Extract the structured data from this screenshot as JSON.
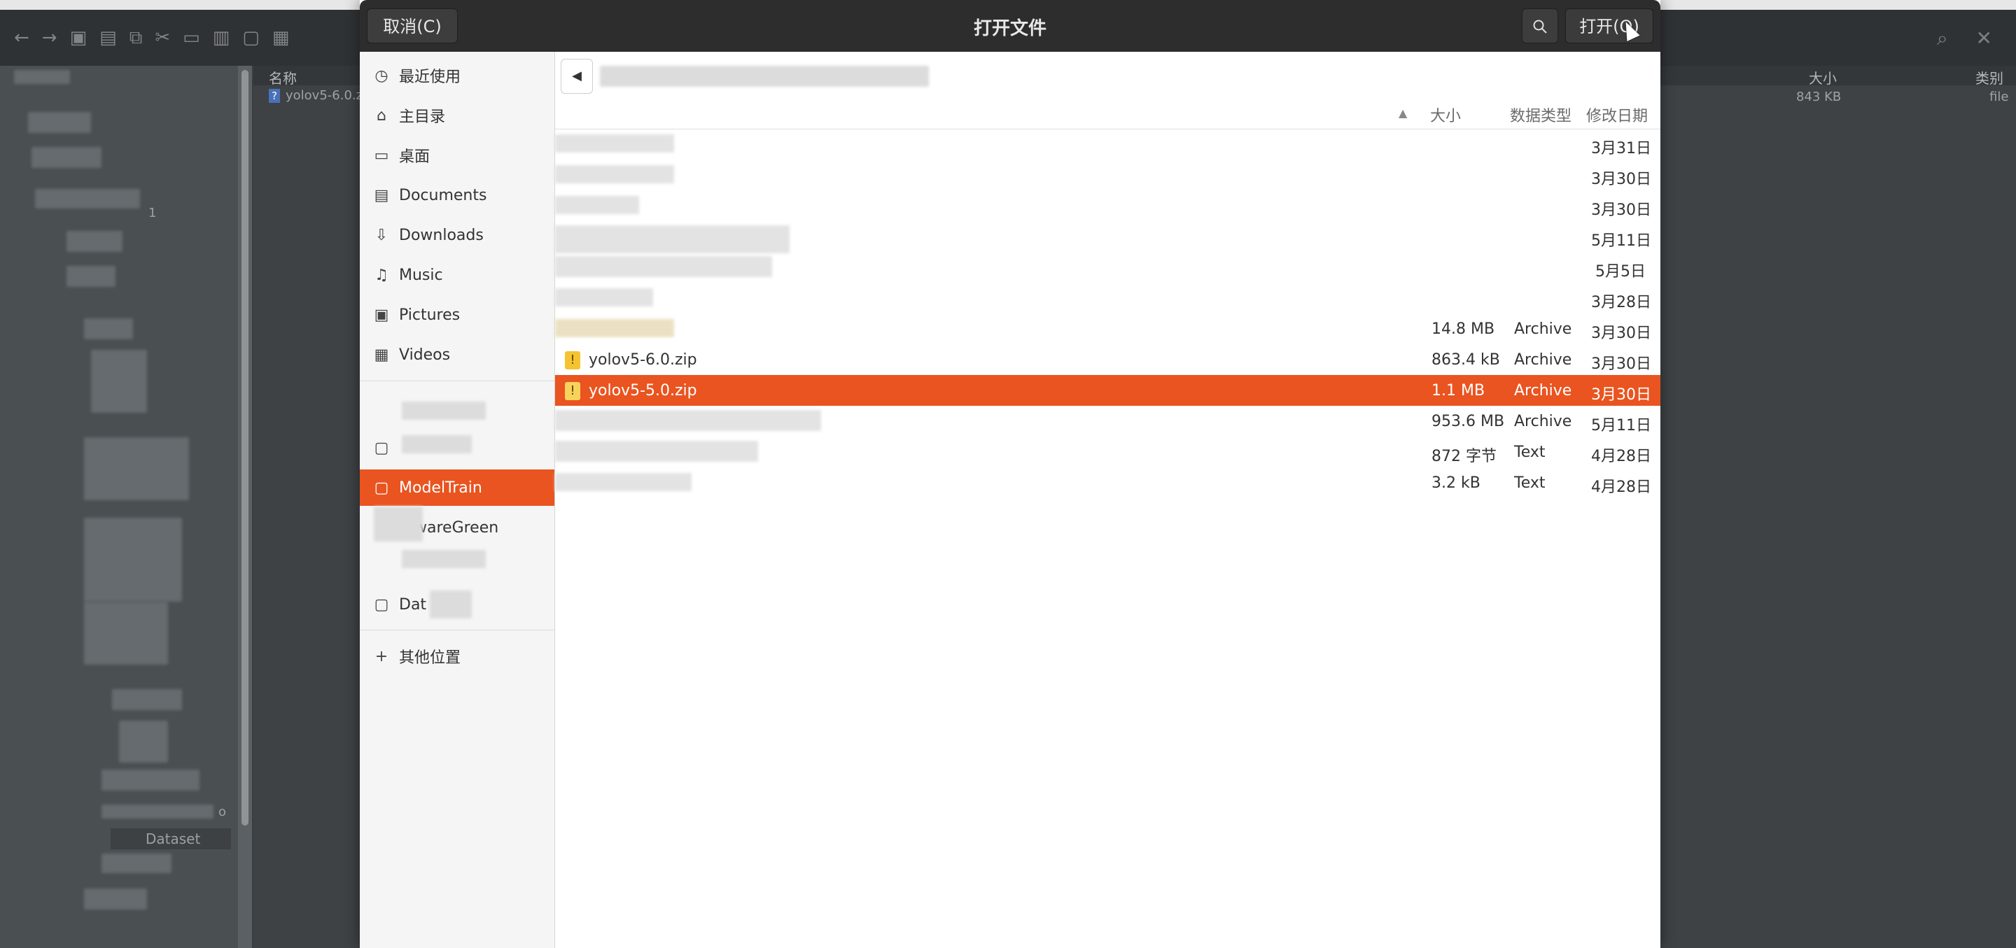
{
  "background": {
    "header": {
      "name_label": "名称",
      "size_label": "大小",
      "type_label": "类别"
    },
    "file": {
      "name": "yolov5-6.0.z",
      "size": "843 KB",
      "type": "file"
    },
    "folder_label": "Dataset",
    "tree_label_fragment": "1",
    "tree_label_fragment_2": "o"
  },
  "dialog": {
    "title": "打开文件",
    "cancel_label": "取消(C)",
    "open_label": "打开(O)",
    "search_icon": "search-icon",
    "places": [
      {
        "label": "最近使用",
        "icon": "clock-icon"
      },
      {
        "label": "主目录",
        "icon": "home-icon"
      },
      {
        "label": "桌面",
        "icon": "desktop-icon"
      },
      {
        "label": "Documents",
        "icon": "document-icon"
      },
      {
        "label": "Downloads",
        "icon": "download-icon"
      },
      {
        "label": "Music",
        "icon": "music-icon"
      },
      {
        "label": "Pictures",
        "icon": "picture-icon"
      },
      {
        "label": "Videos",
        "icon": "video-icon"
      }
    ],
    "bookmarks": [
      {
        "label": "ModelTrain",
        "icon": "folder-icon",
        "active": true
      },
      {
        "label": "wareGreen",
        "icon": "folder-icon"
      },
      {
        "label": "Dat",
        "icon": "folder-icon"
      }
    ],
    "other_locations_label": "其他位置",
    "columns": {
      "size": "大小",
      "type": "数据类型",
      "modified": "修改日期"
    },
    "rows": [
      {
        "name": "",
        "size": "",
        "type": "",
        "modified": "3月31日"
      },
      {
        "name": "",
        "size": "",
        "type": "",
        "modified": "3月30日"
      },
      {
        "name": "",
        "size": "",
        "type": "",
        "modified": "3月30日"
      },
      {
        "name": "",
        "size": "",
        "type": "",
        "modified": "5月11日"
      },
      {
        "name": "",
        "size": "",
        "type": "",
        "modified": "5月5日"
      },
      {
        "name": "",
        "size": "",
        "type": "",
        "modified": "3月28日"
      },
      {
        "name": "",
        "size": "14.8 MB",
        "type": "Archive",
        "modified": "3月30日"
      },
      {
        "name": "yolov5-6.0.zip",
        "size": "863.4 kB",
        "type": "Archive",
        "modified": "3月30日"
      },
      {
        "name": "yolov5-5.0.zip",
        "size": "1.1 MB",
        "type": "Archive",
        "modified": "3月30日",
        "selected": true
      },
      {
        "name": "",
        "size": "953.6 MB",
        "type": "Archive",
        "modified": "5月11日"
      },
      {
        "name": "",
        "size": "872 字节",
        "type": "Text",
        "modified": "4月28日"
      },
      {
        "name": "",
        "size": "3.2 kB",
        "type": "Text",
        "modified": "4月28日"
      }
    ]
  },
  "colors": {
    "accent": "#e95420",
    "titlebar": "#2d2d2d"
  }
}
